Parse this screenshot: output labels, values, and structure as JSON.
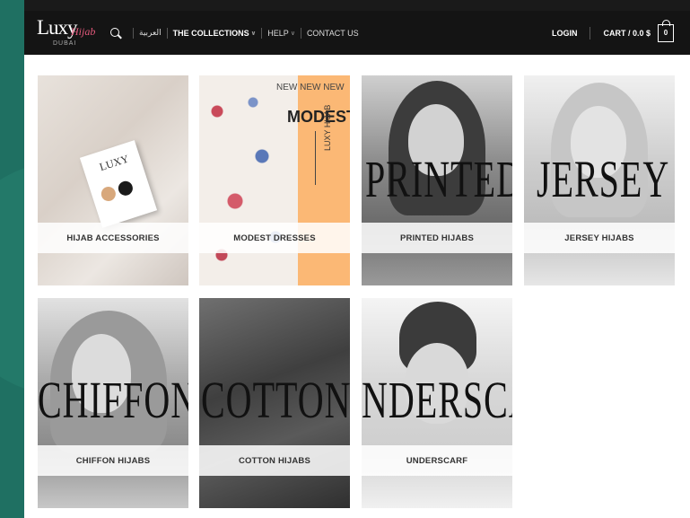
{
  "header": {
    "logo": {
      "main": "Luxy",
      "script": "Hijab",
      "sub": "DUBAI"
    },
    "nav": {
      "language": "العربية",
      "collections": "THE COLLECTIONS",
      "help": "HELP",
      "contact": "CONTACT US"
    },
    "login": "LOGIN",
    "cart": "CART / 0.0 $",
    "cart_count": "0"
  },
  "tiles": [
    {
      "label": "HIJAB ACCESSORIES",
      "image_text": "LUXY"
    },
    {
      "label": "MODEST DRESSES",
      "image_text_new": "NEW NEW NEW",
      "image_text_title": "MODEST",
      "image_text_brand": "LUXY HIJAB"
    },
    {
      "label": "PRINTED HIJABS",
      "image_text": "PRINTED"
    },
    {
      "label": "JERSEY HIJABS",
      "image_text": "JERSEY"
    },
    {
      "label": "CHIFFON HIJABS",
      "image_text": "CHIFFON"
    },
    {
      "label": "COTTON HIJABS",
      "image_text": "COTTON"
    },
    {
      "label": "UNDERSCARF",
      "image_text": "NDERSCAR"
    }
  ]
}
